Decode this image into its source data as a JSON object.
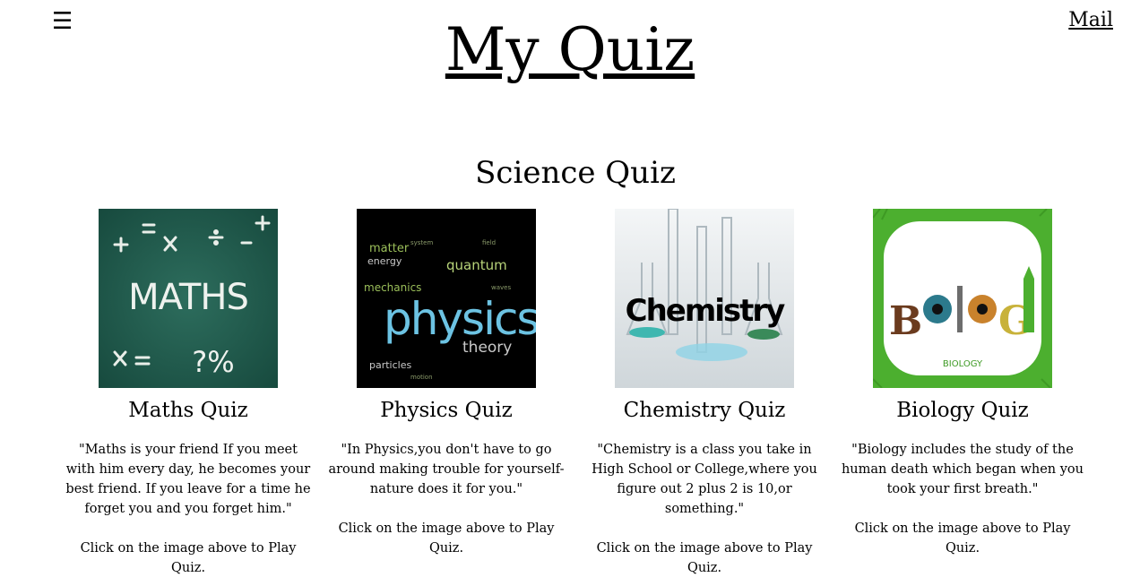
{
  "header": {
    "menu_icon": "hamburger-icon",
    "title": "My Quiz",
    "mail_label": "Mail"
  },
  "section": {
    "title": "Science Quiz"
  },
  "cards": [
    {
      "title": "Maths Quiz",
      "image_icon": "maths-chalkboard-image",
      "image_text": "MATHS",
      "quote": "\"Maths is your friend If you meet with him every day, he becomes your best friend. If you leave for a time he forget you and you forget him.\"",
      "hint": "Click on the image above to Play Quiz."
    },
    {
      "title": "Physics Quiz",
      "image_icon": "physics-wordcloud-image",
      "image_text": "physics",
      "quote": "\"In Physics,you don't have to go around making trouble for yourself-nature does it for you.\"",
      "hint": "Click on the image above to Play Quiz."
    },
    {
      "title": "Chemistry Quiz",
      "image_icon": "chemistry-glassware-image",
      "image_text": "Chemistry",
      "quote": "\"Chemistry is a class you take in High School or College,where you figure out 2 plus 2 is 10,or something.\"",
      "hint": "Click on the image above to Play Quiz."
    },
    {
      "title": "Biology Quiz",
      "image_icon": "biology-grass-image",
      "image_text": "BIOLOGY",
      "quote": "\"Biology includes the study of the human death which began when you took your first breath.\"",
      "hint": "Click on the image above to Play Quiz."
    }
  ],
  "colors": {
    "maths_board": "#1f5a4c",
    "physics_bg": "#000000",
    "physics_accent": "#5fb7d6",
    "chemistry_bg": "#e8ecef",
    "biology_grass": "#4caf2f"
  }
}
